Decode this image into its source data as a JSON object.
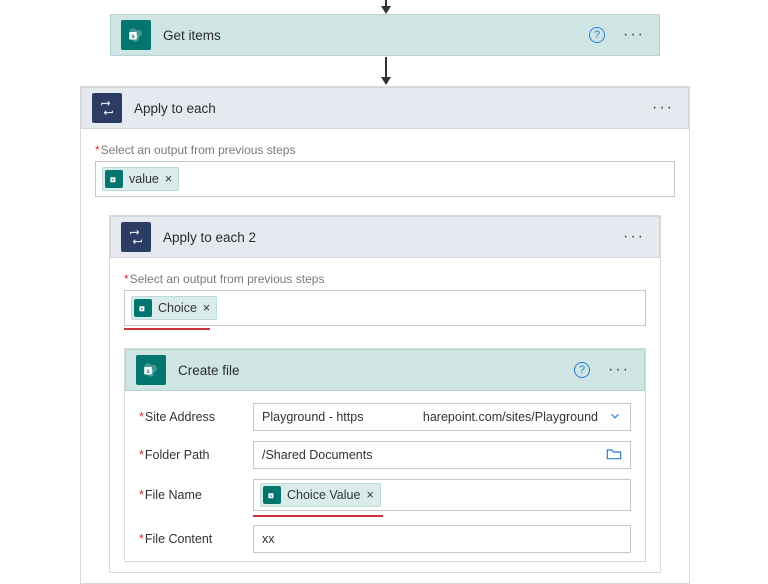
{
  "get_items": {
    "title": "Get items"
  },
  "apply_each_1": {
    "title": "Apply to each",
    "select_label": "Select an output from previous steps",
    "token": "value"
  },
  "apply_each_2": {
    "title": "Apply to each 2",
    "select_label": "Select an output from previous steps",
    "token": "Choice"
  },
  "create_file": {
    "title": "Create file",
    "fields": {
      "site_address": {
        "label": "Site Address",
        "left": "Playground - https",
        "right": "harepoint.com/sites/Playground"
      },
      "folder_path": {
        "label": "Folder Path",
        "value": "/Shared Documents"
      },
      "file_name": {
        "label": "File Name",
        "token": "Choice Value"
      },
      "file_content": {
        "label": "File Content",
        "value": "xx"
      }
    }
  }
}
